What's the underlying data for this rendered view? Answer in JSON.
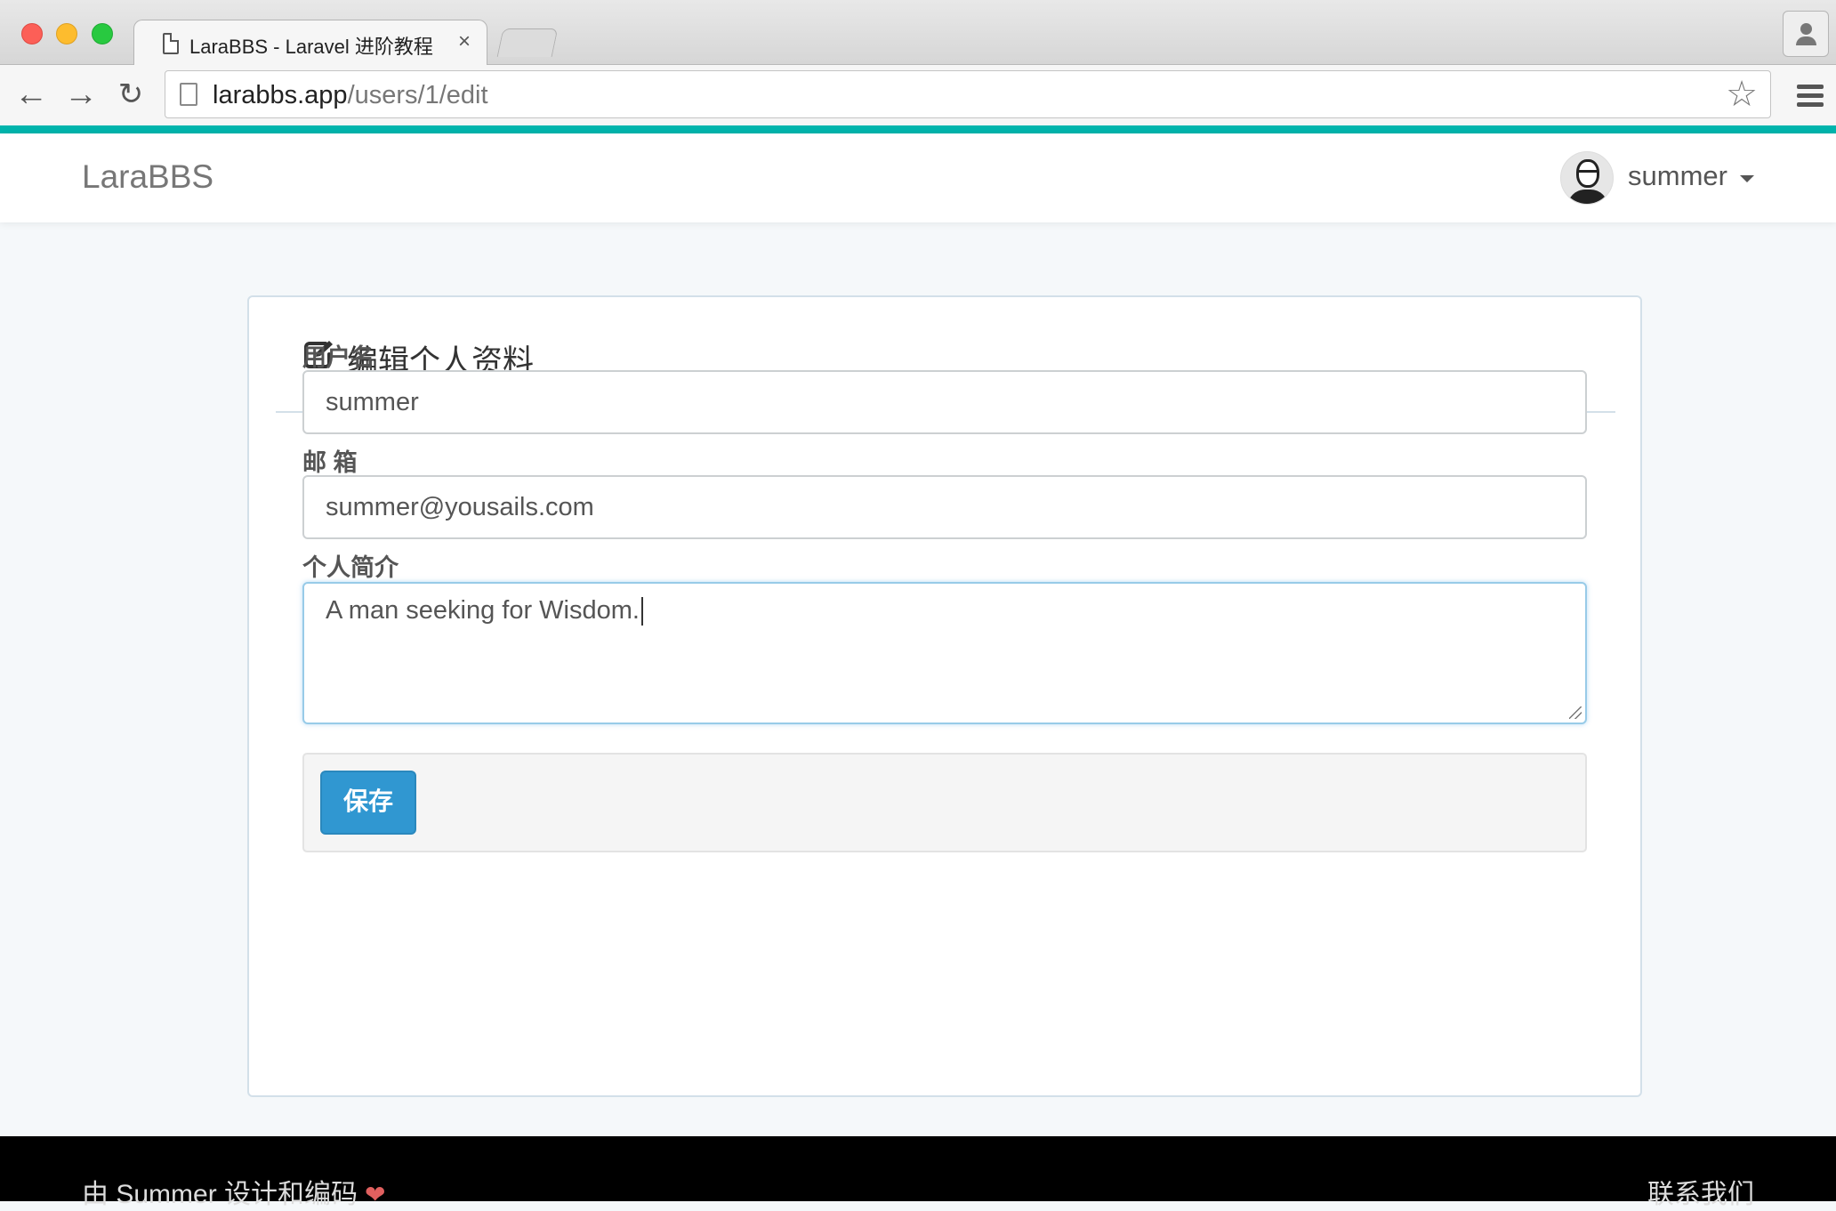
{
  "browser": {
    "tab_title": "LaraBBS - Laravel 进阶教程",
    "tab_close": "×",
    "url_host": "larabbs.app",
    "url_path": "/users/1/edit",
    "back_icon": "back-arrow-icon",
    "forward_icon": "forward-arrow-icon",
    "reload_icon": "reload-icon",
    "star_icon": "bookmark-star-icon",
    "menu_icon": "hamburger-menu-icon"
  },
  "navbar": {
    "brand": "LaraBBS",
    "user_name": "summer",
    "accent_color": "#00b5ad"
  },
  "panel": {
    "title": "编辑个人资料",
    "fields": {
      "username": {
        "label": "用户名",
        "value": "summer"
      },
      "email": {
        "label": "邮 箱",
        "value": "summer@yousails.com"
      },
      "introduction": {
        "label": "个人简介",
        "value": "A man seeking for Wisdom."
      }
    },
    "save_label": "保存",
    "save_color": "#3097d1"
  },
  "footer": {
    "left_text": "由 Summer 设计和编码",
    "heart": "❤",
    "right_text": "联系我们"
  }
}
